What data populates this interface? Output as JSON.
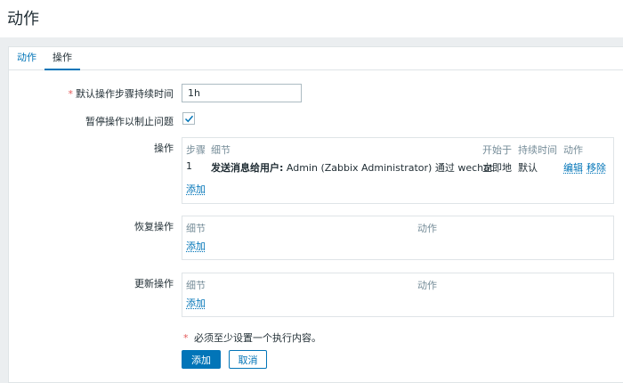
{
  "page": {
    "title": "动作"
  },
  "tabs": [
    {
      "label": "动作",
      "active": false
    },
    {
      "label": "操作",
      "active": true
    }
  ],
  "form": {
    "duration": {
      "label": "默认操作步骤持续时间",
      "required": true,
      "value": "1h"
    },
    "pause": {
      "label": "暂停操作以制止问题",
      "checked": true
    },
    "operations": {
      "label": "操作",
      "headers": {
        "step": "步骤",
        "detail": "细节",
        "start": "开始于",
        "duration": "持续时间",
        "action": "动作"
      },
      "rows": [
        {
          "step": "1",
          "detail_bold": "发送消息给用户:",
          "detail_rest": " Admin (Zabbix Administrator) 通过 wechat",
          "start": "立即地",
          "duration": "默认",
          "edit": "编辑",
          "remove": "移除"
        }
      ],
      "add": "添加"
    },
    "recovery": {
      "label": "恢复操作",
      "headers": {
        "detail": "细节",
        "action": "动作"
      },
      "add": "添加"
    },
    "update": {
      "label": "更新操作",
      "headers": {
        "detail": "细节",
        "action": "动作"
      },
      "add": "添加"
    },
    "note": {
      "asterisk": "*",
      "text": " 必须至少设置一个执行内容。"
    },
    "buttons": {
      "add": "添加",
      "cancel": "取消"
    }
  },
  "colors": {
    "accent": "#0275b8",
    "required": "#e45959",
    "muted": "#768d99"
  }
}
